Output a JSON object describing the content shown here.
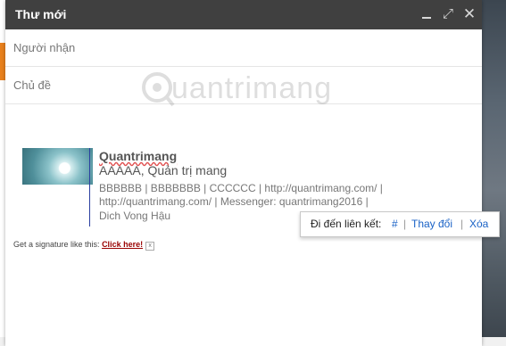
{
  "compose": {
    "title": "Thư mới",
    "controls": {
      "minimize": "minimize-icon",
      "expand": "expand-icon",
      "close": "close-icon"
    },
    "to_label": "Người nhận",
    "subject_label": "Chủ đề"
  },
  "watermark": {
    "text": "uantrimang"
  },
  "signature": {
    "name": "Quantrimang",
    "role": "AAAAA, Quản trị mang",
    "line2": "BBBBBB | BBBBBBB | CCCCCC | http://quantrimang.com/ |",
    "line3": "http://quantrimang.com/ | Messenger: quantrimang2016 |",
    "address": "Dich Vong Hậu"
  },
  "get_signature": {
    "text": "Get a signature like this: ",
    "link": "Click here!",
    "close": "x"
  },
  "link_popup": {
    "label": "Đi đến liên kết:",
    "go": "#",
    "sep": "|",
    "edit": "Thay đổi",
    "delete": "Xóa"
  }
}
